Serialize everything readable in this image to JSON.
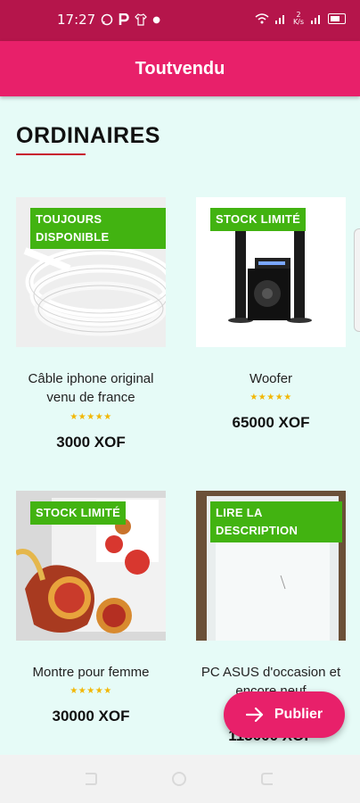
{
  "status_bar": {
    "time": "17:27",
    "net_speed": "2 K/s",
    "colors": {
      "background": "#b5154b"
    }
  },
  "app_bar": {
    "title": "Toutvendu",
    "color": "#e8206a"
  },
  "section": {
    "title": "ORDINAIRES"
  },
  "products": [
    {
      "badge": "TOUJOURS\nDISPONIBLE",
      "name": "Câble iphone original venu de france",
      "rating_stars": "★★★★★",
      "price": "3000 XOF"
    },
    {
      "badge": "STOCK LIMITÉ",
      "name": "Woofer",
      "rating_stars": "★★★★★",
      "price": "65000 XOF"
    },
    {
      "badge": "STOCK LIMITÉ",
      "name": "Montre pour femme",
      "rating_stars": "★★★★★",
      "price": "30000 XOF"
    },
    {
      "badge": "LIRE LA\nDESCRIPTION",
      "name": "PC ASUS d'occasion et encore neuf",
      "rating_stars": "★★★★★",
      "price": "115000 XOF"
    }
  ],
  "fab": {
    "label": "Publier",
    "icon": "arrow-right-icon"
  },
  "badge_color": "#42b311"
}
